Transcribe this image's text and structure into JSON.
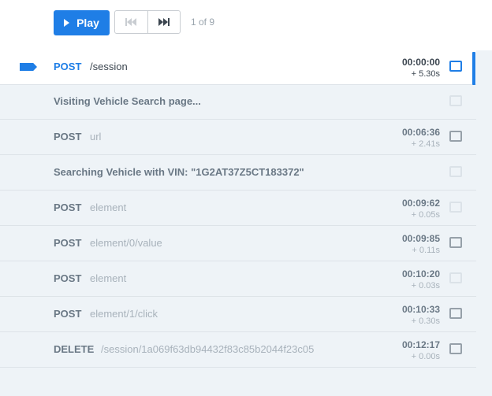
{
  "toolbar": {
    "play_label": "Play",
    "counter": "1 of 9"
  },
  "colors": {
    "accent": "#1f7ee6",
    "list_bg": "#eef3f7",
    "muted_text": "#a8b2bb",
    "strong_text": "#6a7885"
  },
  "commands": [
    {
      "method": "POST",
      "path": "/session",
      "time": "00:00:00",
      "delta": "+ 5.30s"
    },
    {
      "message": "Visiting Vehicle Search page..."
    },
    {
      "method": "POST",
      "path": "url",
      "time": "00:06:36",
      "delta": "+ 2.41s"
    },
    {
      "message": "Searching Vehicle with VIN: \"1G2AT37Z5CT183372\""
    },
    {
      "method": "POST",
      "path": "element",
      "time": "00:09:62",
      "delta": "+ 0.05s"
    },
    {
      "method": "POST",
      "path": "element/0/value",
      "time": "00:09:85",
      "delta": "+ 0.11s"
    },
    {
      "method": "POST",
      "path": "element",
      "time": "00:10:20",
      "delta": "+ 0.03s"
    },
    {
      "method": "POST",
      "path": "element/1/click",
      "time": "00:10:33",
      "delta": "+ 0.30s"
    },
    {
      "method": "DELETE",
      "path": "/session/1a069f63db94432f83c85b2044f23c05",
      "time": "00:12:17",
      "delta": "+ 0.00s"
    }
  ]
}
